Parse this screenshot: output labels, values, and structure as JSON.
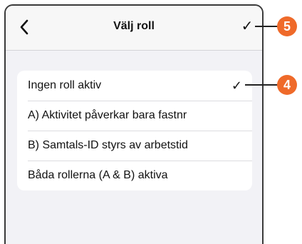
{
  "navbar": {
    "title": "Välj roll",
    "done_glyph": "✓"
  },
  "roles": [
    {
      "label": "Ingen roll aktiv",
      "selected": true,
      "check_glyph": "✓"
    },
    {
      "label": "A) Aktivitet påverkar bara fastnr",
      "selected": false
    },
    {
      "label": "B) Samtals-ID styrs av arbetstid",
      "selected": false
    },
    {
      "label": "Båda rollerna (A & B) aktiva",
      "selected": false
    }
  ],
  "callouts": {
    "done_number": "5",
    "selected_number": "4",
    "color": "#ef6a2a"
  },
  "icons": {
    "back": "chevron-left-icon",
    "done": "checkmark-icon",
    "selected": "checkmark-icon"
  }
}
